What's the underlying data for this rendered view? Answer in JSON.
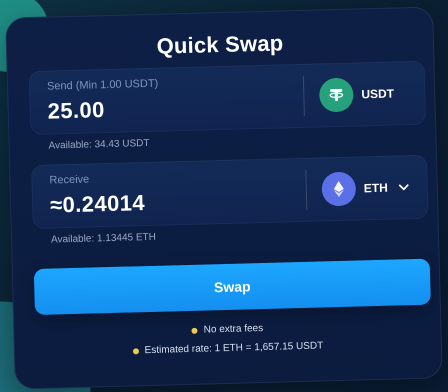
{
  "app": {
    "title": "Quick Swap"
  },
  "send": {
    "label": "Send (Min 1.00 USDT)",
    "amount": "25.00",
    "token": "USDT",
    "token_icon": "tether-icon",
    "available": "Available: 34.43 USDT"
  },
  "receive": {
    "label": "Receive",
    "amount": "≈0.24014",
    "token": "ETH",
    "token_icon": "ethereum-icon",
    "available": "Available: 1.13445 ETH",
    "dropdown_icon": "chevron-down-icon"
  },
  "actions": {
    "swap_label": "Swap"
  },
  "info": {
    "line1": "No extra fees",
    "line2": "Estimated rate: 1 ETH = 1,657.15 USDT"
  },
  "colors": {
    "accent": "#1da7ff",
    "card": "#0e1f46",
    "field": "#132a57",
    "usdt": "#26a17b",
    "eth": "#5b6fe6",
    "info_dot": "#f2c84b"
  }
}
